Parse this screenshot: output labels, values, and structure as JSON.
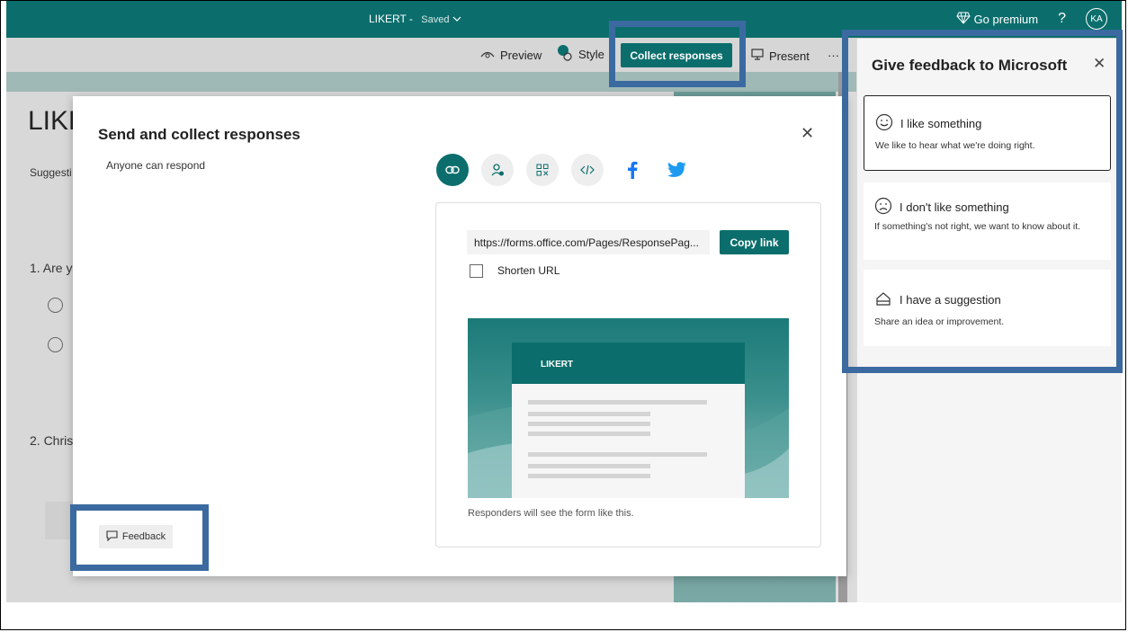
{
  "header": {
    "form_name": "LIKERT",
    "save_status": "Saved",
    "go_premium": "Go premium",
    "help": "?",
    "avatar_initials": "KA"
  },
  "toolbar": {
    "preview": "Preview",
    "style": "Style",
    "collect": "Collect responses",
    "present": "Present",
    "more": "···"
  },
  "form": {
    "title": "LIKERT",
    "subtitle": "Suggesti",
    "q1": "1. Are y",
    "q2": "2. Chris"
  },
  "modal": {
    "title": "Send and collect responses",
    "audience": "Anyone can respond",
    "url": "https://forms.office.com/Pages/ResponsePag...",
    "copy_link": "Copy link",
    "shorten_url": "Shorten URL",
    "preview_title": "LIKERT",
    "preview_note": "Responders will see the form like this.",
    "feedback": "Feedback",
    "share_options": [
      "link-icon",
      "person-add-icon",
      "qr-code-icon",
      "embed-code-icon",
      "facebook-icon",
      "twitter-icon"
    ]
  },
  "feedback_panel": {
    "title": "Give feedback to Microsoft",
    "items": [
      {
        "label": "I like something",
        "desc": "We like to hear what we're doing right.",
        "icon": "smile-icon"
      },
      {
        "label": "I don't like something",
        "desc": "If something's not right, we want to know about it.",
        "icon": "frown-icon"
      },
      {
        "label": "I have a suggestion",
        "desc": "Share an idea or improvement.",
        "icon": "lightbulb-icon"
      }
    ]
  },
  "colors": {
    "brand": "#0b6e6c",
    "highlight": "#3b6aa0"
  }
}
